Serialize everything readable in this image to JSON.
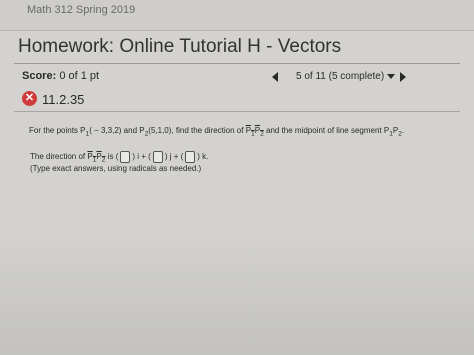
{
  "course": "Math 312 Spring 2019",
  "title": "Homework: Online Tutorial H - Vectors",
  "score": {
    "label": "Score:",
    "value": "0 of 1 pt"
  },
  "nav": {
    "progress": "5 of 11 (5 complete)"
  },
  "question": {
    "number": "11.2.35",
    "prompt_prefix": "For the points",
    "p1_label": "P",
    "p1_sub": "1",
    "p1_coords": "( − 3,3,2)",
    "and": " and ",
    "p2_label": "P",
    "p2_sub": "2",
    "p2_coords": "(5,1,0),",
    "prompt_mid": " find the direction of ",
    "vec_label": "P1P2",
    "prompt_end": " and the midpoint of line segment P",
    "seg_sub1": "1",
    "seg_p2": "P",
    "seg_sub2": "2",
    "period": "."
  },
  "answer": {
    "prefix": "The direction of",
    "vec_label": "P1P2",
    "is": "is",
    "i": "i +",
    "j": "j +",
    "k": "k.",
    "hint": "(Type exact answers, using radicals as needed.)"
  },
  "colors": {
    "background": "#d3d2cf",
    "status_incorrect": "#cf3b3b"
  },
  "icons": {
    "status": "incorrect-x-icon",
    "prev": "triangle-left-icon",
    "next": "triangle-right-icon",
    "dropdown": "chevron-down-icon"
  }
}
